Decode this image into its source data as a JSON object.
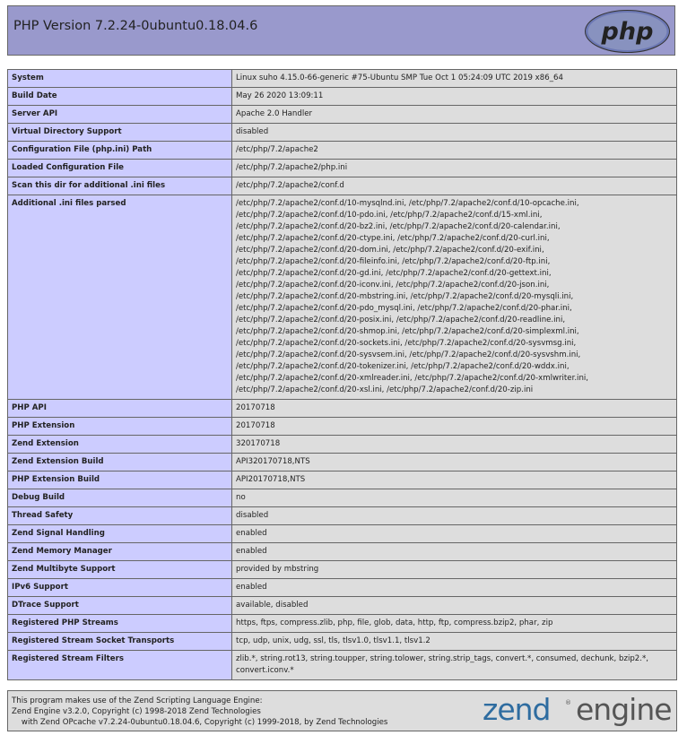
{
  "header": {
    "title": "PHP Version 7.2.24-0ubuntu0.18.04.6",
    "logo_text": "php"
  },
  "rows": [
    {
      "key": "System",
      "value": "Linux suho 4.15.0-66-generic #75-Ubuntu SMP Tue Oct 1 05:24:09 UTC 2019 x86_64"
    },
    {
      "key": "Build Date",
      "value": "May 26 2020 13:09:11"
    },
    {
      "key": "Server API",
      "value": "Apache 2.0 Handler"
    },
    {
      "key": "Virtual Directory Support",
      "value": "disabled"
    },
    {
      "key": "Configuration File (php.ini) Path",
      "value": "/etc/php/7.2/apache2"
    },
    {
      "key": "Loaded Configuration File",
      "value": "/etc/php/7.2/apache2/php.ini"
    },
    {
      "key": "Scan this dir for additional .ini files",
      "value": "/etc/php/7.2/apache2/conf.d"
    },
    {
      "key": "Additional .ini files parsed",
      "value": "/etc/php/7.2/apache2/conf.d/10-mysqlnd.ini, /etc/php/7.2/apache2/conf.d/10-opcache.ini,\n/etc/php/7.2/apache2/conf.d/10-pdo.ini, /etc/php/7.2/apache2/conf.d/15-xml.ini,\n/etc/php/7.2/apache2/conf.d/20-bz2.ini, /etc/php/7.2/apache2/conf.d/20-calendar.ini,\n/etc/php/7.2/apache2/conf.d/20-ctype.ini, /etc/php/7.2/apache2/conf.d/20-curl.ini,\n/etc/php/7.2/apache2/conf.d/20-dom.ini, /etc/php/7.2/apache2/conf.d/20-exif.ini,\n/etc/php/7.2/apache2/conf.d/20-fileinfo.ini, /etc/php/7.2/apache2/conf.d/20-ftp.ini,\n/etc/php/7.2/apache2/conf.d/20-gd.ini, /etc/php/7.2/apache2/conf.d/20-gettext.ini,\n/etc/php/7.2/apache2/conf.d/20-iconv.ini, /etc/php/7.2/apache2/conf.d/20-json.ini,\n/etc/php/7.2/apache2/conf.d/20-mbstring.ini, /etc/php/7.2/apache2/conf.d/20-mysqli.ini,\n/etc/php/7.2/apache2/conf.d/20-pdo_mysql.ini, /etc/php/7.2/apache2/conf.d/20-phar.ini,\n/etc/php/7.2/apache2/conf.d/20-posix.ini, /etc/php/7.2/apache2/conf.d/20-readline.ini,\n/etc/php/7.2/apache2/conf.d/20-shmop.ini, /etc/php/7.2/apache2/conf.d/20-simplexml.ini,\n/etc/php/7.2/apache2/conf.d/20-sockets.ini, /etc/php/7.2/apache2/conf.d/20-sysvmsg.ini,\n/etc/php/7.2/apache2/conf.d/20-sysvsem.ini, /etc/php/7.2/apache2/conf.d/20-sysvshm.ini,\n/etc/php/7.2/apache2/conf.d/20-tokenizer.ini, /etc/php/7.2/apache2/conf.d/20-wddx.ini,\n/etc/php/7.2/apache2/conf.d/20-xmlreader.ini, /etc/php/7.2/apache2/conf.d/20-xmlwriter.ini,\n/etc/php/7.2/apache2/conf.d/20-xsl.ini, /etc/php/7.2/apache2/conf.d/20-zip.ini"
    },
    {
      "key": "PHP API",
      "value": "20170718"
    },
    {
      "key": "PHP Extension",
      "value": "20170718"
    },
    {
      "key": "Zend Extension",
      "value": "320170718"
    },
    {
      "key": "Zend Extension Build",
      "value": "API320170718,NTS"
    },
    {
      "key": "PHP Extension Build",
      "value": "API20170718,NTS"
    },
    {
      "key": "Debug Build",
      "value": "no"
    },
    {
      "key": "Thread Safety",
      "value": "disabled"
    },
    {
      "key": "Zend Signal Handling",
      "value": "enabled"
    },
    {
      "key": "Zend Memory Manager",
      "value": "enabled"
    },
    {
      "key": "Zend Multibyte Support",
      "value": "provided by mbstring"
    },
    {
      "key": "IPv6 Support",
      "value": "enabled"
    },
    {
      "key": "DTrace Support",
      "value": "available, disabled"
    },
    {
      "key": "Registered PHP Streams",
      "value": "https, ftps, compress.zlib, php, file, glob, data, http, ftp, compress.bzip2, phar, zip"
    },
    {
      "key": "Registered Stream Socket Transports",
      "value": "tcp, udp, unix, udg, ssl, tls, tlsv1.0, tlsv1.1, tlsv1.2"
    },
    {
      "key": "Registered Stream Filters",
      "value": "zlib.*, string.rot13, string.toupper, string.tolower, string.strip_tags, convert.*, consumed, dechunk, bzip2.*,\nconvert.iconv.*"
    }
  ],
  "footer": {
    "text": "This program makes use of the Zend Scripting Language Engine:\nZend Engine v3.2.0, Copyright (c) 1998-2018 Zend Technologies\n    with Zend OPcache v7.2.24-0ubuntu0.18.04.6, Copyright (c) 1999-2018, by Zend Technologies",
    "logo_word1": "zend",
    "logo_word2": "engine",
    "logo_mark": "®"
  },
  "colors": {
    "header_bg": "#9999cc",
    "key_bg": "#ccccff",
    "value_bg": "#dddddd",
    "php_logo": "#6c78b4",
    "zend_blue": "#2e6ca0"
  }
}
